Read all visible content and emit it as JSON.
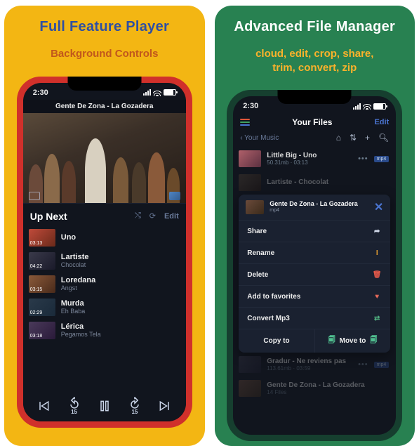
{
  "left": {
    "title": "Full Feature Player",
    "subtitle": "Background Controls",
    "status_time": "2:30",
    "now_playing": "Gente De Zona - La Gozadera",
    "section_title": "Up Next",
    "edit_label": "Edit",
    "skip_back": "15",
    "skip_fwd": "15",
    "queue": [
      {
        "time": "03:13",
        "title": "Uno",
        "sub": ""
      },
      {
        "time": "04:22",
        "title": "Lartiste",
        "sub": "Chocolat"
      },
      {
        "time": "03:15",
        "title": "Loredana",
        "sub": "Angst"
      },
      {
        "time": "02:29",
        "title": "Murda",
        "sub": "Eh Baba"
      },
      {
        "time": "03:18",
        "title": "Lérica",
        "sub": "Pegamos Tela"
      }
    ]
  },
  "right": {
    "title": "Advanced File Manager",
    "subtitle": "cloud, edit, crop, share,\ntrim, convert, zip",
    "status_time": "2:30",
    "header": "Your Files",
    "edit_label": "Edit",
    "breadcrumb": "‹ Your Music",
    "badge": "mp4",
    "files": [
      {
        "title": "Little Big - Uno",
        "sub": "50.31mb · 03:13"
      },
      {
        "title": "Lartiste - Chocolat",
        "sub": ""
      },
      {
        "title": "Gradur - Ne reviens pas",
        "sub": "113.61mb · 03:59"
      },
      {
        "title": "Gente De Zona - La Gozadera",
        "sub": "14 Files"
      }
    ],
    "sheet": {
      "title": "Gente De Zona - La Gozadera",
      "sub": "mp4",
      "share": "Share",
      "rename": "Rename",
      "delete": "Delete",
      "fav": "Add to favorites",
      "conv": "Convert Mp3",
      "copy": "Copy to",
      "move": "Move to"
    }
  }
}
